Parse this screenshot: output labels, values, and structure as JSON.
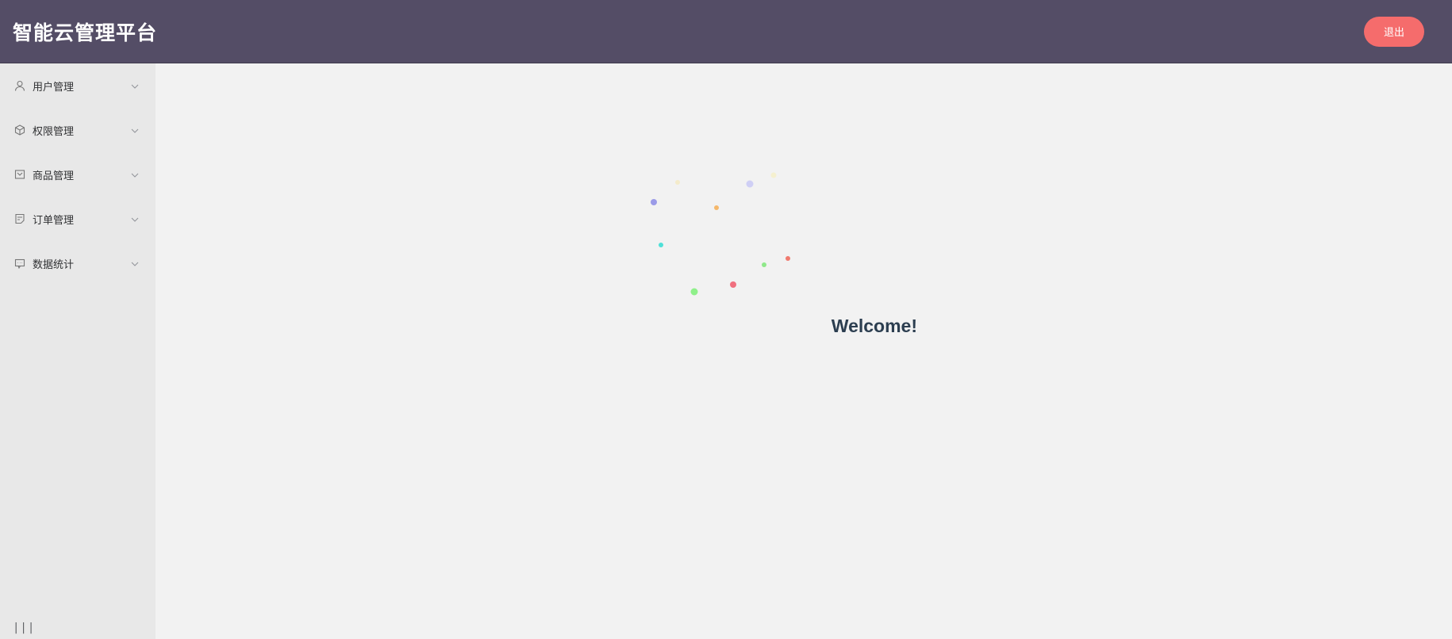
{
  "header": {
    "title": "智能云管理平台",
    "logout_label": "退出",
    "background": "#544d66",
    "logout_color": "#f56c6c"
  },
  "sidebar": {
    "items": [
      {
        "label": "用户管理",
        "icon": "user-icon"
      },
      {
        "label": "权限管理",
        "icon": "cube-icon"
      },
      {
        "label": "商品管理",
        "icon": "inbox-icon"
      },
      {
        "label": "订单管理",
        "icon": "document-icon"
      },
      {
        "label": "数据统计",
        "icon": "chat-monitor-icon"
      }
    ],
    "collapse_label": "|||"
  },
  "main": {
    "welcome_text": "Welcome!",
    "particle_colors": [
      "#9b9be8",
      "#f5e6b0",
      "#cfcff5",
      "#f7f0c0",
      "#f5b86b",
      "#4fe0d8",
      "#f07a6e",
      "#8fe88a",
      "#f0707f",
      "#8ff08a"
    ]
  }
}
